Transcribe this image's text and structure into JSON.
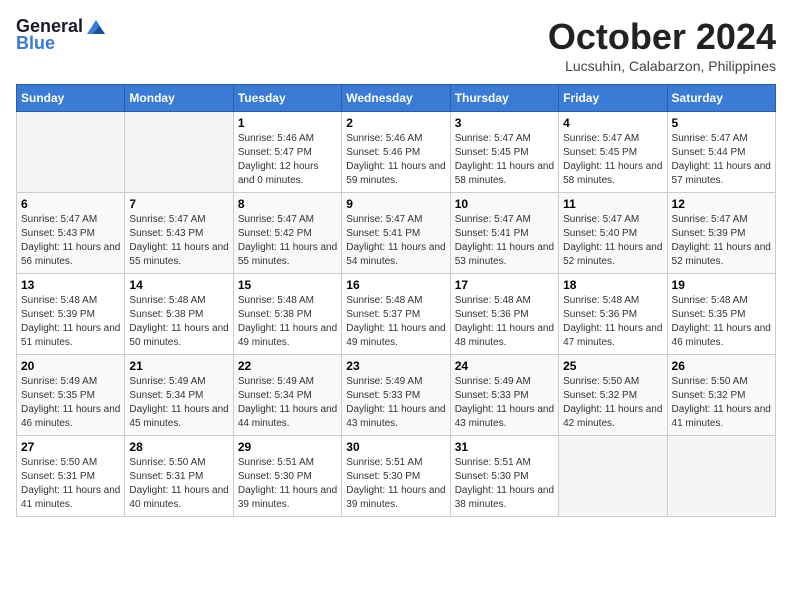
{
  "logo": {
    "general": "General",
    "blue": "Blue"
  },
  "title": "October 2024",
  "location": "Lucsuhin, Calabarzon, Philippines",
  "days_of_week": [
    "Sunday",
    "Monday",
    "Tuesday",
    "Wednesday",
    "Thursday",
    "Friday",
    "Saturday"
  ],
  "weeks": [
    [
      {
        "day": "",
        "sunrise": "",
        "sunset": "",
        "daylight": ""
      },
      {
        "day": "",
        "sunrise": "",
        "sunset": "",
        "daylight": ""
      },
      {
        "day": "1",
        "sunrise": "Sunrise: 5:46 AM",
        "sunset": "Sunset: 5:47 PM",
        "daylight": "Daylight: 12 hours and 0 minutes."
      },
      {
        "day": "2",
        "sunrise": "Sunrise: 5:46 AM",
        "sunset": "Sunset: 5:46 PM",
        "daylight": "Daylight: 11 hours and 59 minutes."
      },
      {
        "day": "3",
        "sunrise": "Sunrise: 5:47 AM",
        "sunset": "Sunset: 5:45 PM",
        "daylight": "Daylight: 11 hours and 58 minutes."
      },
      {
        "day": "4",
        "sunrise": "Sunrise: 5:47 AM",
        "sunset": "Sunset: 5:45 PM",
        "daylight": "Daylight: 11 hours and 58 minutes."
      },
      {
        "day": "5",
        "sunrise": "Sunrise: 5:47 AM",
        "sunset": "Sunset: 5:44 PM",
        "daylight": "Daylight: 11 hours and 57 minutes."
      }
    ],
    [
      {
        "day": "6",
        "sunrise": "Sunrise: 5:47 AM",
        "sunset": "Sunset: 5:43 PM",
        "daylight": "Daylight: 11 hours and 56 minutes."
      },
      {
        "day": "7",
        "sunrise": "Sunrise: 5:47 AM",
        "sunset": "Sunset: 5:43 PM",
        "daylight": "Daylight: 11 hours and 55 minutes."
      },
      {
        "day": "8",
        "sunrise": "Sunrise: 5:47 AM",
        "sunset": "Sunset: 5:42 PM",
        "daylight": "Daylight: 11 hours and 55 minutes."
      },
      {
        "day": "9",
        "sunrise": "Sunrise: 5:47 AM",
        "sunset": "Sunset: 5:41 PM",
        "daylight": "Daylight: 11 hours and 54 minutes."
      },
      {
        "day": "10",
        "sunrise": "Sunrise: 5:47 AM",
        "sunset": "Sunset: 5:41 PM",
        "daylight": "Daylight: 11 hours and 53 minutes."
      },
      {
        "day": "11",
        "sunrise": "Sunrise: 5:47 AM",
        "sunset": "Sunset: 5:40 PM",
        "daylight": "Daylight: 11 hours and 52 minutes."
      },
      {
        "day": "12",
        "sunrise": "Sunrise: 5:47 AM",
        "sunset": "Sunset: 5:39 PM",
        "daylight": "Daylight: 11 hours and 52 minutes."
      }
    ],
    [
      {
        "day": "13",
        "sunrise": "Sunrise: 5:48 AM",
        "sunset": "Sunset: 5:39 PM",
        "daylight": "Daylight: 11 hours and 51 minutes."
      },
      {
        "day": "14",
        "sunrise": "Sunrise: 5:48 AM",
        "sunset": "Sunset: 5:38 PM",
        "daylight": "Daylight: 11 hours and 50 minutes."
      },
      {
        "day": "15",
        "sunrise": "Sunrise: 5:48 AM",
        "sunset": "Sunset: 5:38 PM",
        "daylight": "Daylight: 11 hours and 49 minutes."
      },
      {
        "day": "16",
        "sunrise": "Sunrise: 5:48 AM",
        "sunset": "Sunset: 5:37 PM",
        "daylight": "Daylight: 11 hours and 49 minutes."
      },
      {
        "day": "17",
        "sunrise": "Sunrise: 5:48 AM",
        "sunset": "Sunset: 5:36 PM",
        "daylight": "Daylight: 11 hours and 48 minutes."
      },
      {
        "day": "18",
        "sunrise": "Sunrise: 5:48 AM",
        "sunset": "Sunset: 5:36 PM",
        "daylight": "Daylight: 11 hours and 47 minutes."
      },
      {
        "day": "19",
        "sunrise": "Sunrise: 5:48 AM",
        "sunset": "Sunset: 5:35 PM",
        "daylight": "Daylight: 11 hours and 46 minutes."
      }
    ],
    [
      {
        "day": "20",
        "sunrise": "Sunrise: 5:49 AM",
        "sunset": "Sunset: 5:35 PM",
        "daylight": "Daylight: 11 hours and 46 minutes."
      },
      {
        "day": "21",
        "sunrise": "Sunrise: 5:49 AM",
        "sunset": "Sunset: 5:34 PM",
        "daylight": "Daylight: 11 hours and 45 minutes."
      },
      {
        "day": "22",
        "sunrise": "Sunrise: 5:49 AM",
        "sunset": "Sunset: 5:34 PM",
        "daylight": "Daylight: 11 hours and 44 minutes."
      },
      {
        "day": "23",
        "sunrise": "Sunrise: 5:49 AM",
        "sunset": "Sunset: 5:33 PM",
        "daylight": "Daylight: 11 hours and 43 minutes."
      },
      {
        "day": "24",
        "sunrise": "Sunrise: 5:49 AM",
        "sunset": "Sunset: 5:33 PM",
        "daylight": "Daylight: 11 hours and 43 minutes."
      },
      {
        "day": "25",
        "sunrise": "Sunrise: 5:50 AM",
        "sunset": "Sunset: 5:32 PM",
        "daylight": "Daylight: 11 hours and 42 minutes."
      },
      {
        "day": "26",
        "sunrise": "Sunrise: 5:50 AM",
        "sunset": "Sunset: 5:32 PM",
        "daylight": "Daylight: 11 hours and 41 minutes."
      }
    ],
    [
      {
        "day": "27",
        "sunrise": "Sunrise: 5:50 AM",
        "sunset": "Sunset: 5:31 PM",
        "daylight": "Daylight: 11 hours and 41 minutes."
      },
      {
        "day": "28",
        "sunrise": "Sunrise: 5:50 AM",
        "sunset": "Sunset: 5:31 PM",
        "daylight": "Daylight: 11 hours and 40 minutes."
      },
      {
        "day": "29",
        "sunrise": "Sunrise: 5:51 AM",
        "sunset": "Sunset: 5:30 PM",
        "daylight": "Daylight: 11 hours and 39 minutes."
      },
      {
        "day": "30",
        "sunrise": "Sunrise: 5:51 AM",
        "sunset": "Sunset: 5:30 PM",
        "daylight": "Daylight: 11 hours and 39 minutes."
      },
      {
        "day": "31",
        "sunrise": "Sunrise: 5:51 AM",
        "sunset": "Sunset: 5:30 PM",
        "daylight": "Daylight: 11 hours and 38 minutes."
      },
      {
        "day": "",
        "sunrise": "",
        "sunset": "",
        "daylight": ""
      },
      {
        "day": "",
        "sunrise": "",
        "sunset": "",
        "daylight": ""
      }
    ]
  ]
}
